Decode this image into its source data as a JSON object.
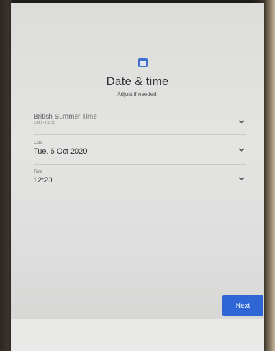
{
  "header": {
    "icon": "calendar-icon",
    "title": "Date & time",
    "subtitle": "Adjust if needed."
  },
  "timezone": {
    "name": "British Summer Time",
    "offset": "GMT+01:00"
  },
  "date": {
    "label": "Date",
    "value": "Tue, 6 Oct 2020"
  },
  "time": {
    "label": "Time",
    "value": "12:20"
  },
  "actions": {
    "next_label": "Next"
  },
  "colors": {
    "accent": "#2f66d6"
  }
}
